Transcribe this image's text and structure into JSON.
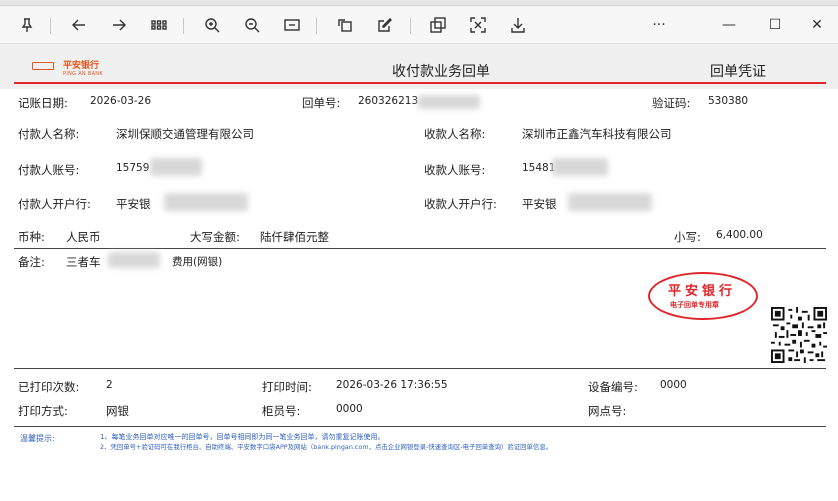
{
  "toolbar": {
    "icons": [
      "pin-icon",
      "back-icon",
      "forward-icon",
      "grid-icon",
      "zoom-in-icon",
      "zoom-out-icon",
      "fit-width-icon",
      "rotate-icon",
      "annotate-icon",
      "copy-icon",
      "select-icon",
      "download-icon",
      "more-icon",
      "minimize-icon",
      "maximize-icon",
      "close-icon"
    ],
    "more_label": "···",
    "minimize_label": "—",
    "maximize_label": "☐",
    "close_label": "✕"
  },
  "receipt": {
    "logo": "平安银行",
    "logo_sub": "PING AN BANK",
    "title": "收付款业务回单",
    "voucher": "回单凭证",
    "date_label": "记账日期:",
    "date_value": "2026-03-26",
    "receipt_no_label": "回单号:",
    "receipt_no_value": "260326213",
    "verify_label": "验证码:",
    "verify_value": "530380",
    "payer_name_label": "付款人名称:",
    "payer_name_value": "深圳保顺交通管理有限公司",
    "payee_name_label": "收款人名称:",
    "payee_name_value": "深圳市正鑫汽车科技有限公司",
    "payer_account_label": "付款人账号:",
    "payer_account_value": "15759",
    "payee_account_label": "收款人账号:",
    "payee_account_value": "15481",
    "payer_bank_label": "付款人开户行:",
    "payer_bank_value": "平安银",
    "payee_bank_label": "收款人开户行:",
    "payee_bank_value": "平安银",
    "currency_label": "币种:",
    "currency_value": "人民币",
    "amount_cn_label": "大写金额:",
    "amount_cn_value": "陆仟肆佰元整",
    "amount_label": "小写:",
    "amount_value": "6,400.00",
    "remark_label": "备注:",
    "remark_value": "三者车",
    "remark_suffix": "费用(网银)",
    "stamp_main": "平安银行",
    "stamp_sub": "电子回单专用章",
    "printed_times_label": "已打印次数:",
    "printed_times_value": "2",
    "print_time_label": "打印时间:",
    "print_time_value": "2026-03-26 17:36:55",
    "device_label": "设备编号:",
    "device_value": "0000",
    "print_method_label": "打印方式:",
    "print_method_value": "网银",
    "teller_label": "柜员号:",
    "teller_value": "0000",
    "branch_label": "网点号:",
    "branch_value": "",
    "tips_label": "温馨提示:",
    "tip1": "1、每笔业务回单对应唯一的回单号，回单号相同即为同一笔业务回单，请勿重复记账使用。",
    "tip2": "2、凭回单号+验证码可在我行柜台、自助终端、平安数字口袋APP及网站（bank.pingan.com，点击企业网银登录-快速查询区-电子回单查询）验证回单信息。"
  },
  "colors": {
    "accent_red": "#e0262a",
    "logo_orange": "#e4571f",
    "tips_blue": "#2f5fbf"
  }
}
